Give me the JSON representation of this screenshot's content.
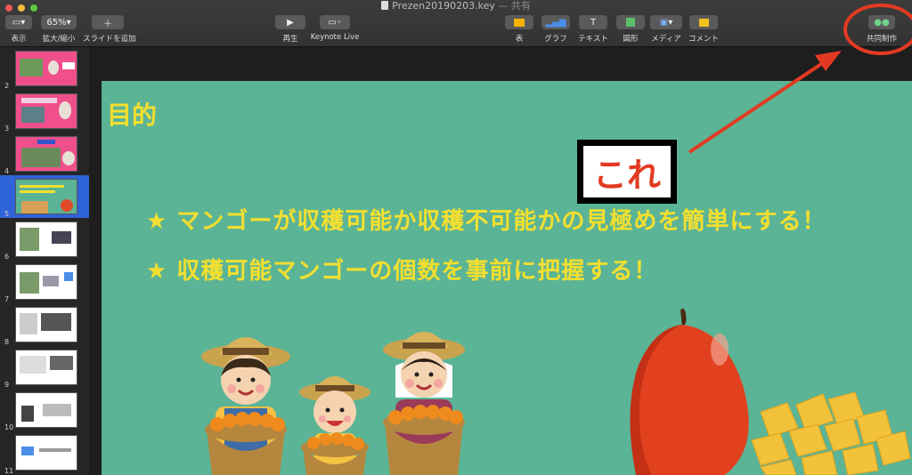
{
  "window": {
    "title": "Prezen20190203.key",
    "shared": "— 共有"
  },
  "toolbar": {
    "view_label": "表示",
    "zoom_value": "65%",
    "zoom_label": "拡大/縮小",
    "add_slide_label": "スライドを追加",
    "play_label": "再生",
    "keynote_live_label": "Keynote Live",
    "table_label": "表",
    "chart_label": "グラフ",
    "text_label": "テキスト",
    "shape_label": "図形",
    "media_label": "メディア",
    "comment_label": "コメント",
    "collaborate_label": "共同制作"
  },
  "navigator": {
    "slides": [
      {
        "number": "2"
      },
      {
        "number": "3"
      },
      {
        "number": "4"
      },
      {
        "number": "5",
        "selected": true
      },
      {
        "number": "6"
      },
      {
        "number": "7"
      },
      {
        "number": "8"
      },
      {
        "number": "9"
      },
      {
        "number": "10"
      },
      {
        "number": "11"
      }
    ]
  },
  "slide": {
    "title": "目的",
    "bullets": [
      "★ マンゴーが収穫可能か収穫不可能かの見極めを簡単にする！",
      "★ 収穫可能マンゴーの個数を事前に把握する！"
    ]
  },
  "annotation": {
    "callout_text": "これ"
  },
  "colors": {
    "slide_bg": "#5bb495",
    "title_yellow": "#f3df2f",
    "annotation_red": "#e23a22",
    "selection_blue": "#2f63d8"
  }
}
